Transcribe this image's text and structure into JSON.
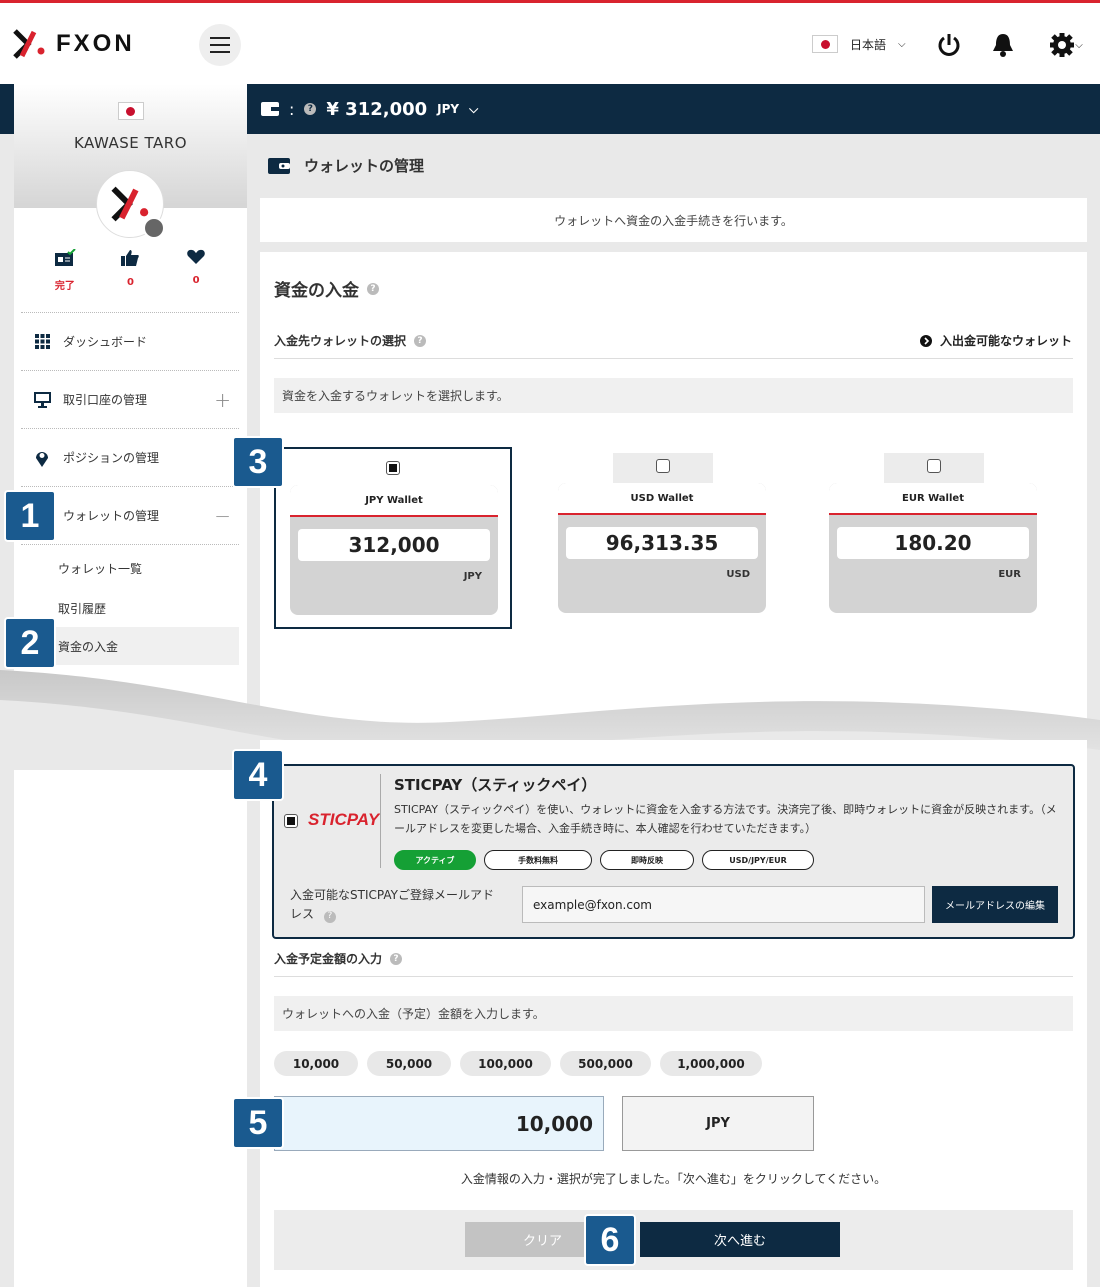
{
  "header": {
    "logo_text": "FXON",
    "language": "日本語",
    "icons": [
      "menu-icon",
      "power-icon",
      "bell-icon",
      "gear-icon"
    ]
  },
  "wallet_bar": {
    "separator": ":",
    "help": "?",
    "amount": "¥ 312,000",
    "currency": "JPY"
  },
  "sidebar": {
    "user_name": "KAWASE TARO",
    "stats": [
      {
        "icon": "verified-id-icon",
        "value": "完了"
      },
      {
        "icon": "thumbs-up-icon",
        "value": "0"
      },
      {
        "icon": "heart-icon",
        "value": "0"
      }
    ],
    "menu": [
      {
        "label": "ダッシュボード",
        "icon": "grid-icon",
        "toggle": ""
      },
      {
        "label": "取引口座の管理",
        "icon": "monitor-icon",
        "toggle": "+"
      },
      {
        "label": "ポジションの管理",
        "icon": "pin-icon",
        "toggle": ""
      },
      {
        "label": "ウォレットの管理",
        "icon": "",
        "toggle": "−"
      }
    ],
    "submenu": [
      "ウォレット一覧",
      "取引履歴",
      "資金の入金"
    ]
  },
  "page": {
    "title": "ウォレットの管理",
    "info": "ウォレットへ資金の入金手続きを行います。",
    "section_title": "資金の入金",
    "help": "?"
  },
  "wallet_select": {
    "heading": "入金先ウォレットの選択",
    "link": "入出金可能なウォレット",
    "note": "資金を入金するウォレットを選択します。",
    "wallets": [
      {
        "name": "JPY Wallet",
        "value": "312,000",
        "currency": "JPY",
        "selected": true
      },
      {
        "name": "USD Wallet",
        "value": "96,313.35",
        "currency": "USD",
        "selected": false
      },
      {
        "name": "EUR Wallet",
        "value": "180.20",
        "currency": "EUR",
        "selected": false
      }
    ]
  },
  "sticpay": {
    "logo": "STICPAY",
    "title": "STICPAY（スティックペイ）",
    "description": "STICPAY（スティックペイ）を使い、ウォレットに資金を入金する方法です。決済完了後、即時ウォレットに資金が反映されます。（メールアドレスを変更した場合、入金手続き時に、本人確認を行わせていただきます。）",
    "tags": [
      "アクティブ",
      "手数料無料",
      "即時反映",
      "USD/JPY/EUR"
    ],
    "email_label": "入金可能なSTICPAYご登録メールアドレス",
    "email_value": "example@fxon.com",
    "edit_button": "メールアドレスの編集"
  },
  "amount": {
    "heading": "入金予定金額の入力",
    "note": "ウォレットへの入金（予定）金額を入力します。",
    "presets": [
      "10,000",
      "50,000",
      "100,000",
      "500,000",
      "1,000,000"
    ],
    "value": "10,000",
    "currency": "JPY",
    "complete_message": "入金情報の入力・選択が完了しました。「次へ進む」をクリックしてください。",
    "clear_button": "クリア",
    "next_button": "次へ進む"
  },
  "step_badges": [
    "1",
    "2",
    "3",
    "4",
    "5",
    "6"
  ],
  "colors": {
    "navy": "#0d2a42",
    "red": "#d9232e",
    "green": "#15a035",
    "badge": "#1a5a8f"
  }
}
